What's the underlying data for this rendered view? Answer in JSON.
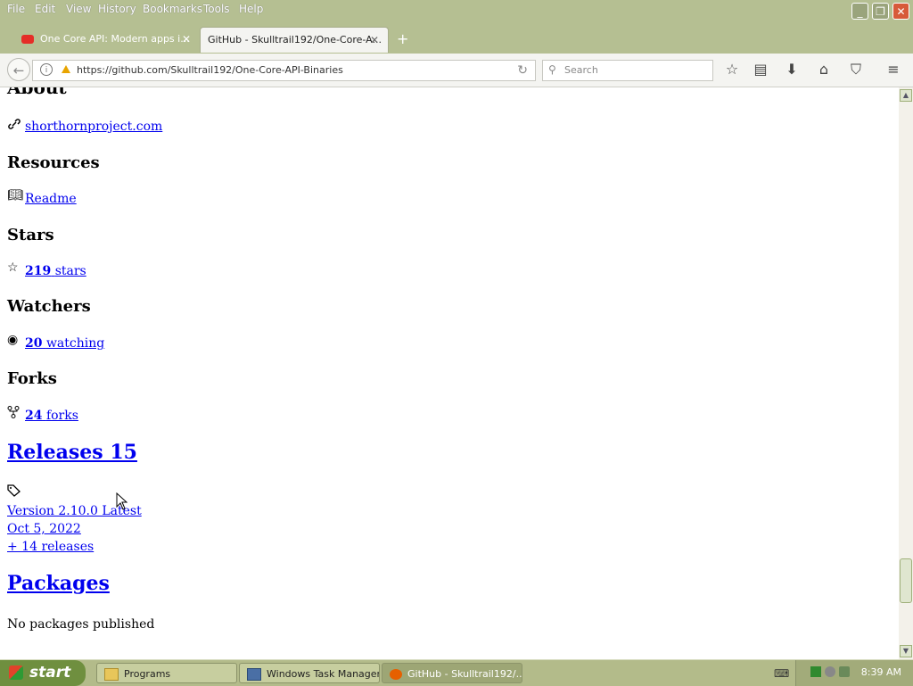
{
  "menubar": {
    "items": [
      "File",
      "Edit",
      "View",
      "History",
      "Bookmarks",
      "Tools",
      "Help"
    ]
  },
  "tabs": [
    {
      "label": "One Core API: Modern apps i...",
      "active": false,
      "favicon": "youtube-icon"
    },
    {
      "label": "GitHub - Skulltrail192/One-Core-A...",
      "active": true,
      "favicon": "github-icon"
    }
  ],
  "navbar": {
    "url": "https://github.com/Skulltrail192/One-Core-API-Binaries",
    "search_placeholder": "Search"
  },
  "page": {
    "about_heading": "About",
    "website_link": "shorthornproject.com",
    "resources_heading": "Resources",
    "readme_link": "Readme",
    "stars_heading": "Stars",
    "stars_count": "219",
    "stars_label": "stars",
    "watchers_heading": "Watchers",
    "watchers_count": "20",
    "watchers_label": "watching",
    "forks_heading": "Forks",
    "forks_count": "24",
    "forks_label": "forks",
    "releases_heading": "Releases 15",
    "release_version": "Version 2.10.0 Latest",
    "release_date": "Oct 5, 2022",
    "more_releases": "+ 14 releases",
    "packages_heading": "Packages",
    "packages_text": "No packages published"
  },
  "taskbar": {
    "start_label": "start",
    "tasks": [
      "Programs",
      "Windows Task Manager",
      "GitHub - Skulltrail192/..."
    ],
    "clock": "8:39 AM"
  }
}
